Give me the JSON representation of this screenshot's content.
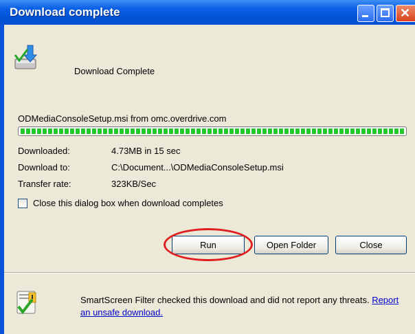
{
  "window": {
    "title": "Download complete"
  },
  "header": {
    "heading": "Download Complete",
    "icon": "download-complete-icon"
  },
  "download": {
    "source": "ODMediaConsoleSetup.msi from omc.overdrive.com",
    "progress_percent": 100,
    "rows": [
      {
        "label": "Downloaded:",
        "value": "4.73MB in 15 sec"
      },
      {
        "label": "Download to:",
        "value": "C:\\Document...\\ODMediaConsoleSetup.msi"
      },
      {
        "label": "Transfer rate:",
        "value": "323KB/Sec"
      }
    ]
  },
  "options": {
    "close_when_done_label": "Close this dialog box when download completes",
    "close_when_done_checked": false
  },
  "buttons": {
    "run": "Run",
    "open_folder": "Open Folder",
    "close": "Close"
  },
  "smartscreen": {
    "text": "SmartScreen Filter checked this download and did not report any threats.",
    "link": "Report an unsafe download.",
    "icon": "smartscreen-shield-icon"
  },
  "colors": {
    "title_bar": "#0a5fe4",
    "client_bg": "#ece9d8",
    "progress_green": "#27c72e",
    "highlight_red": "#e02020",
    "link": "#0000cc"
  }
}
